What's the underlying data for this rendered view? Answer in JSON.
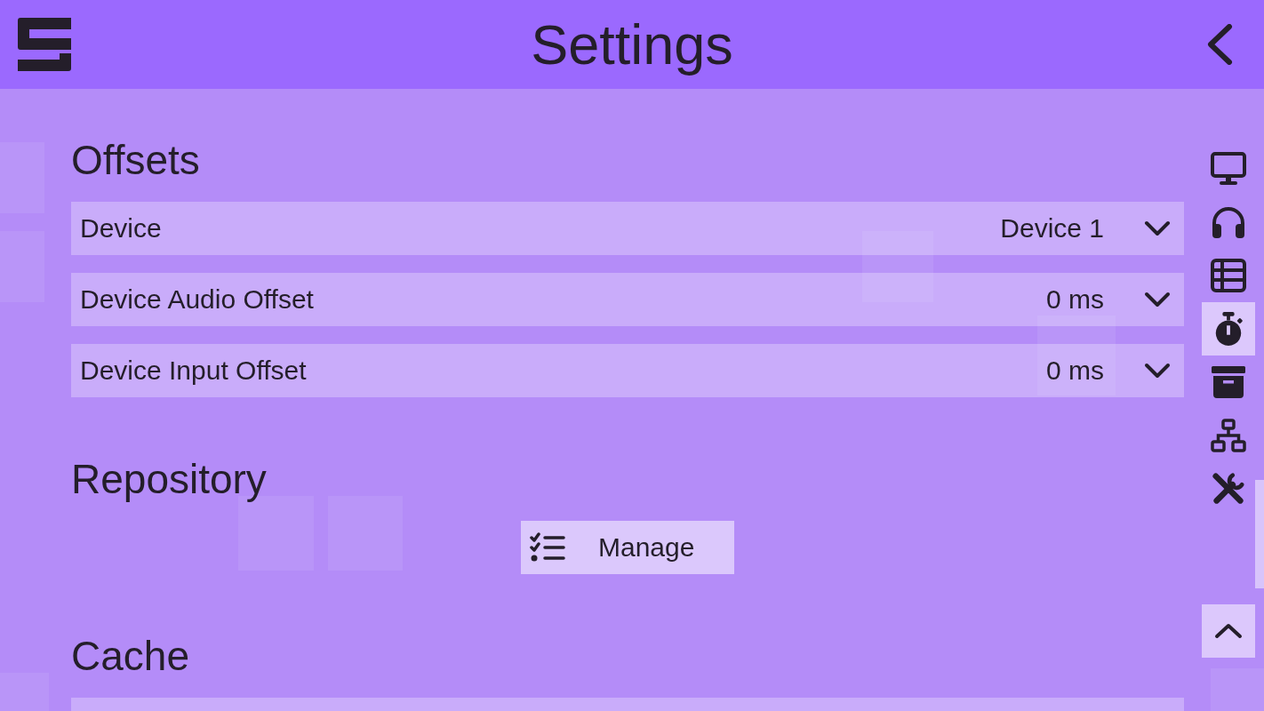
{
  "header": {
    "title": "Settings"
  },
  "sections": [
    {
      "title": "Offsets",
      "kind": "list",
      "rows": [
        {
          "kind": "dropdown",
          "label": "Device",
          "value": "Device 1"
        },
        {
          "kind": "dropdown",
          "label": "Device Audio Offset",
          "value": "0 ms"
        },
        {
          "kind": "dropdown",
          "label": "Device Input Offset",
          "value": "0 ms"
        }
      ]
    },
    {
      "title": "Repository",
      "kind": "actions",
      "buttons": [
        {
          "label": "Manage"
        }
      ]
    },
    {
      "title": "Cache",
      "kind": "list",
      "rows": [
        {
          "kind": "blank"
        }
      ]
    }
  ],
  "sidebar": {
    "items": [
      {
        "kind": "monitor",
        "selected": false
      },
      {
        "kind": "headphones",
        "selected": false
      },
      {
        "kind": "table",
        "selected": false
      },
      {
        "kind": "stopwatch",
        "selected": true
      },
      {
        "kind": "archive",
        "selected": false
      },
      {
        "kind": "network",
        "selected": false
      },
      {
        "kind": "tools",
        "selected": false
      }
    ]
  }
}
